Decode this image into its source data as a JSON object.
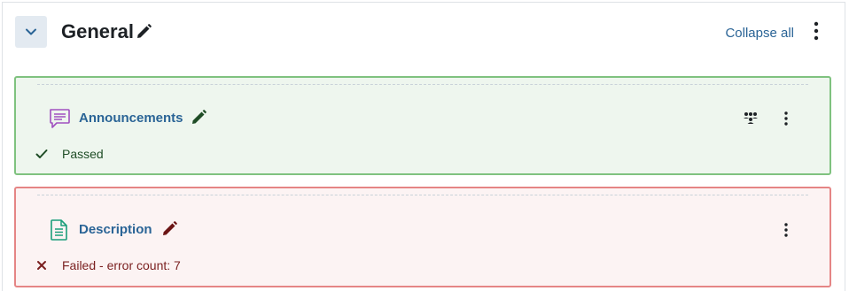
{
  "section": {
    "title": "General",
    "collapse_all_label": "Collapse all"
  },
  "activities": [
    {
      "name": "Announcements",
      "icon": "forum-icon",
      "status_text": "Passed",
      "status": "passed",
      "has_groups_icon": true,
      "border_color": "#7fc27f",
      "background": "#eef6ee"
    },
    {
      "name": "Description",
      "icon": "page-icon",
      "status_text": "Failed - error count: 7",
      "status": "failed",
      "has_groups_icon": false,
      "border_color": "#e58585",
      "background": "#fcf3f3"
    }
  ],
  "colors": {
    "link": "#2a6496",
    "forum_icon": "#a050c0",
    "page_icon": "#1a9e7a",
    "pass_edit_icon": "#1f4d26",
    "fail_edit_icon": "#6b1414"
  }
}
